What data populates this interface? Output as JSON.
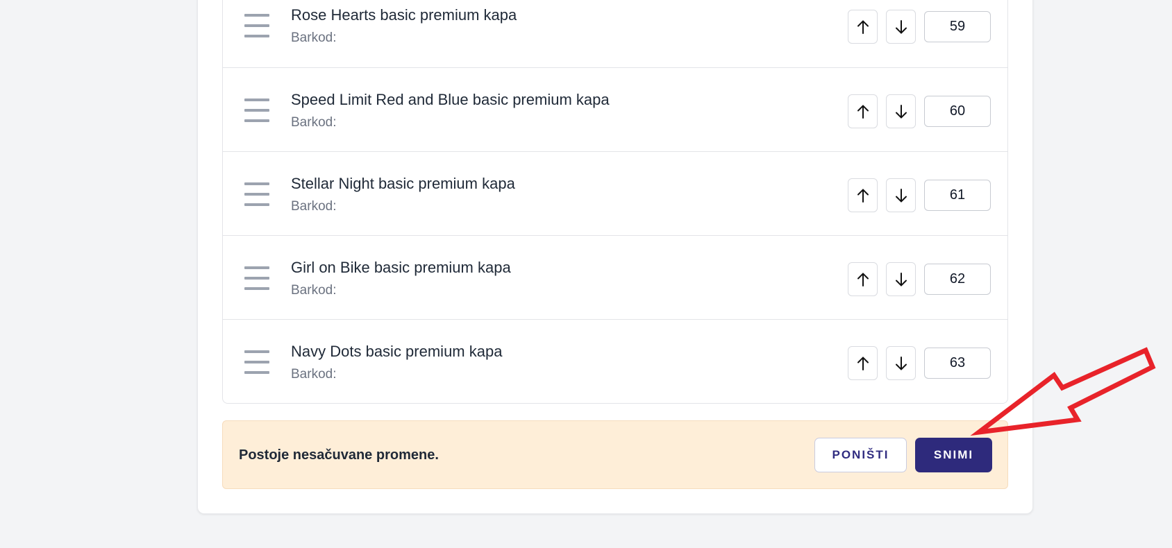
{
  "products": [
    {
      "name": "Rose Hearts basic premium kapa",
      "barcode_label": "Barkod:",
      "position": "59"
    },
    {
      "name": "Speed Limit Red and Blue basic premium kapa",
      "barcode_label": "Barkod:",
      "position": "60"
    },
    {
      "name": "Stellar Night basic premium kapa",
      "barcode_label": "Barkod:",
      "position": "61"
    },
    {
      "name": "Girl on Bike basic premium kapa",
      "barcode_label": "Barkod:",
      "position": "62"
    },
    {
      "name": "Navy Dots basic premium kapa",
      "barcode_label": "Barkod:",
      "position": "63"
    }
  ],
  "icons": {
    "drag": "drag-handle-icon",
    "up": "arrow-up-icon",
    "down": "arrow-down-icon"
  },
  "unsaved_bar": {
    "message": "Postoje nesačuvane promene.",
    "cancel_label": "PONIŠTI",
    "save_label": "SNIMI"
  },
  "colors": {
    "primary": "#2e2a7c",
    "notice_bg": "#feeed8",
    "annotation_arrow": "#e8232a"
  }
}
